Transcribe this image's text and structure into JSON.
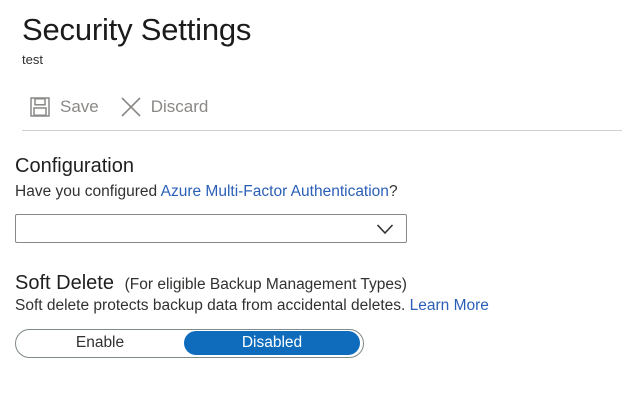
{
  "header": {
    "title": "Security Settings",
    "subtitle": "test"
  },
  "command_bar": {
    "save_label": "Save",
    "discard_label": "Discard",
    "save_icon": "save-icon",
    "discard_icon": "close-icon"
  },
  "configuration": {
    "heading": "Configuration",
    "question_prefix": "Have you configured ",
    "question_link": "Azure Multi-Factor Authentication",
    "question_suffix": "?",
    "dropdown_value": "",
    "dropdown_icon": "chevron-down-icon"
  },
  "soft_delete": {
    "heading": "Soft Delete",
    "heading_note": "(For eligible Backup Management Types)",
    "description": "Soft delete protects backup data from accidental deletes. ",
    "learn_more": "Learn More",
    "toggle": {
      "options": [
        "Enable",
        "Disabled"
      ],
      "selected": "Disabled"
    }
  },
  "colors": {
    "accent": "#0f6cbd",
    "link": "#2b5fb7",
    "muted": "#8a8886"
  }
}
